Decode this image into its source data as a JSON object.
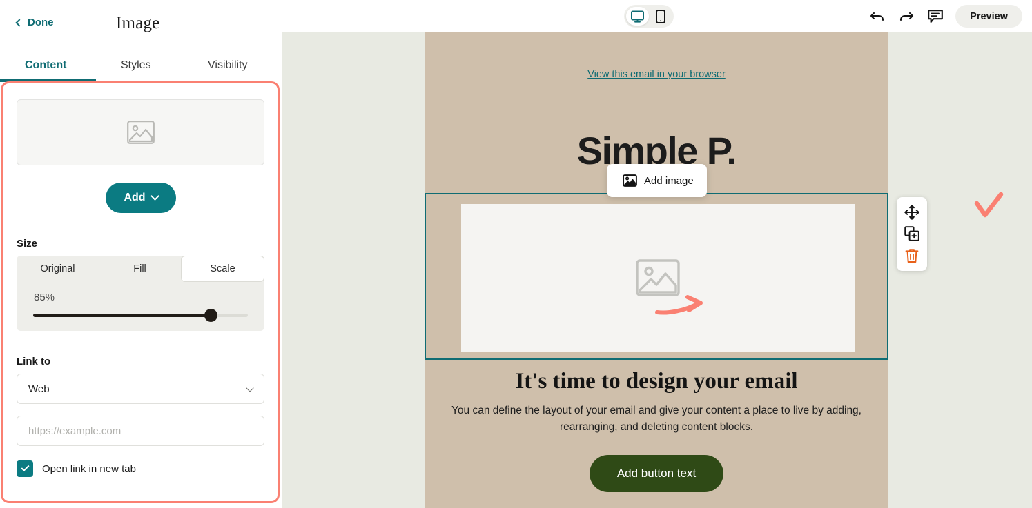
{
  "panel": {
    "done_label": "Done",
    "title": "Image",
    "tabs": [
      {
        "label": "Content",
        "active": true
      },
      {
        "label": "Styles",
        "active": false
      },
      {
        "label": "Visibility",
        "active": false
      }
    ],
    "add_button_label": "Add",
    "size_section_label": "Size",
    "size_options": [
      "Original",
      "Fill",
      "Scale"
    ],
    "size_selected": "Scale",
    "scale_value": "85%",
    "scale_percent": 85,
    "link_section_label": "Link to",
    "link_type_value": "Web",
    "url_placeholder": "https://example.com",
    "url_value": "",
    "new_tab_label": "Open link in new tab",
    "new_tab_checked": true,
    "image_placeholder_icon": "image-placeholder-icon",
    "back_icon": "chevron-left-icon",
    "dropdown_icon": "chevron-down-icon",
    "select_icon": "chevron-down-icon",
    "check_icon": "check-icon"
  },
  "topbar": {
    "device_desktop_icon": "desktop-monitor-icon",
    "device_mobile_icon": "mobile-phone-icon",
    "device_active": "desktop",
    "undo_icon": "undo-arrow-icon",
    "redo_icon": "redo-arrow-icon",
    "comment_icon": "comment-bubble-icon",
    "preview_label": "Preview"
  },
  "canvas": {
    "view_in_browser_link": "View this email in your browser",
    "brand_title": "Simple P.",
    "image_block_placeholder_icon": "image-placeholder-icon",
    "headline": "It's time to design your email",
    "subcopy": "You can define the layout of your email and give your content a place to live by adding, rearranging, and deleting content blocks.",
    "cta_label": "Add button text",
    "add_image_label": "Add image",
    "add_image_icon": "image-placeholder-icon"
  },
  "block_tools": {
    "move_icon": "move-arrows-icon",
    "duplicate_icon": "duplicate-icon",
    "delete_icon": "trash-icon"
  },
  "colors": {
    "teal": "#0f6c73",
    "teal_button": "#0b7b82",
    "annotation_red": "#fa8072",
    "email_background": "#cfbfab",
    "canvas_background": "#e8eae2",
    "cta_green": "#2f4a16",
    "delete_orange": "#e8611a"
  }
}
